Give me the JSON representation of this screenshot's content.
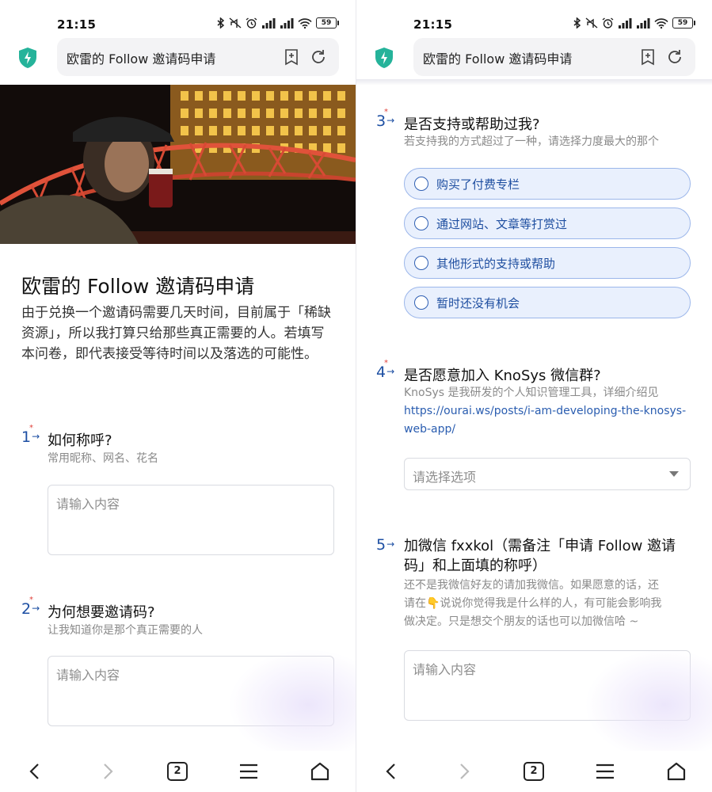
{
  "status": {
    "time": "21:15",
    "battery": "59"
  },
  "address": {
    "title": "欧雷的 Follow 邀请码申请"
  },
  "form": {
    "title": "欧雷的 Follow 邀请码申请",
    "description": "由于兑换一个邀请码需要几天时间，目前属于「稀缺资源」，所以我打算只给那些真正需要的人。若填写本问卷，即代表接受等待时间以及落选的可能性。"
  },
  "questions": {
    "q1": {
      "number": "1",
      "title": "如何称呼?",
      "hint": "常用昵称、网名、花名",
      "placeholder": "请输入内容"
    },
    "q2": {
      "number": "2",
      "title": "为何想要邀请码?",
      "hint": "让我知道你是那个真正需要的人",
      "placeholder": "请输入内容"
    },
    "q3": {
      "number": "3",
      "title": "是否支持或帮助过我?",
      "hint": "若支持我的方式超过了一种，请选择力度最大的那个",
      "options": [
        "购买了付费专栏",
        "通过网站、文章等打赏过",
        "其他形式的支持或帮助",
        "暂时还没有机会"
      ]
    },
    "q4": {
      "number": "4",
      "title": "是否愿意加入 KnoSys 微信群?",
      "hint": "KnoSys 是我研发的个人知识管理工具，详细介绍见",
      "link": "https://ourai.ws/posts/i-am-developing-the-knosys-web-app/",
      "placeholder": "请选择选项"
    },
    "q5": {
      "number": "5",
      "title_line1": "加微信 fxxkol（需备注「申请 Follow 邀请",
      "title_line2": "码」和上面填的称呼）",
      "hint_line1": "还不是我微信好友的请加我微信。如果愿意的话，还",
      "hint_line2": "请在👇说说你觉得我是什么样的人，有可能会影响我",
      "hint_line3": "做决定。只是想交个朋友的话也可以加微信哈 ~",
      "placeholder": "请输入内容"
    }
  },
  "nav": {
    "tab_count": "2"
  },
  "colors": {
    "accent": "#1d4fa3",
    "option_bg": "#e9f0fd",
    "option_border": "#9bb6ea",
    "required": "#e0413a",
    "shield": "#25b39a"
  }
}
